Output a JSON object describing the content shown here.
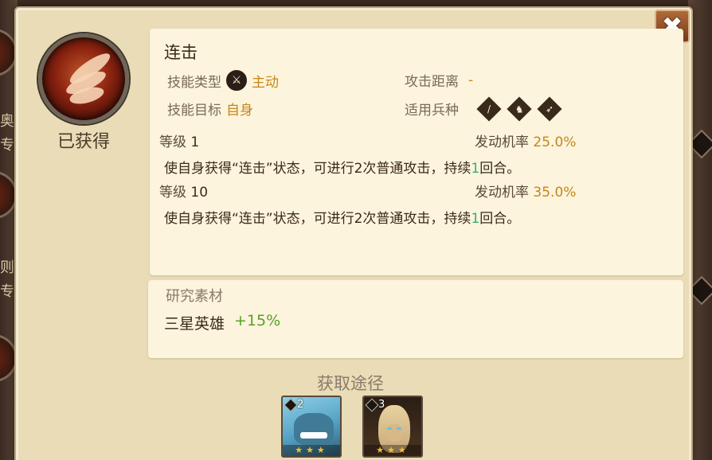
{
  "skill": {
    "name": "连击",
    "status": "已获得",
    "type_label": "技能类型",
    "type_value": "主动",
    "type_icon": "sword-slash-icon",
    "target_label": "技能目标",
    "target_value": "自身",
    "range_label": "攻击距离",
    "range_value": "-",
    "troop_label": "适用兵种",
    "troop_icons": [
      "sword-troop-icon",
      "horse-troop-icon",
      "bow-troop-icon"
    ]
  },
  "levels": [
    {
      "level_label": "等级",
      "level": "1",
      "rate_label": "发动机率",
      "rate": "25.0%",
      "desc_prefix": "使自身获得“连击”状态，可进行2次普通攻击，持续",
      "desc_num": "1",
      "desc_suffix": "回合。"
    },
    {
      "level_label": "等级",
      "level": "10",
      "rate_label": "发动机率",
      "rate": "35.0%",
      "desc_prefix": "使自身获得“连击”状态，可进行2次普通攻击，持续",
      "desc_num": "1",
      "desc_suffix": "回合。"
    }
  ],
  "research": {
    "title": "研究素材",
    "item": "三星英雄",
    "bonus": "+15%"
  },
  "sources": {
    "title": "获取途径",
    "heroes": [
      {
        "badge": "2",
        "badge_icon": "horse-troop-icon",
        "stars": "★★★",
        "colors": {
          "bg": "#5aa6c8",
          "figure": "#2f5f78"
        }
      },
      {
        "badge": "3",
        "badge_icon": "bow-troop-icon",
        "stars": "★★★",
        "colors": {
          "bg": "#3a2a1a",
          "figure": "#d8b888"
        }
      }
    ]
  },
  "background": {
    "left_labels": [
      "奥",
      "专",
      "则",
      "专"
    ]
  },
  "colors": {
    "panel": "#e9dcb6",
    "box": "#fcf4dc",
    "accent_orange": "#c4861a",
    "accent_green": "#2fb36a",
    "close_button": "#9a5028"
  }
}
